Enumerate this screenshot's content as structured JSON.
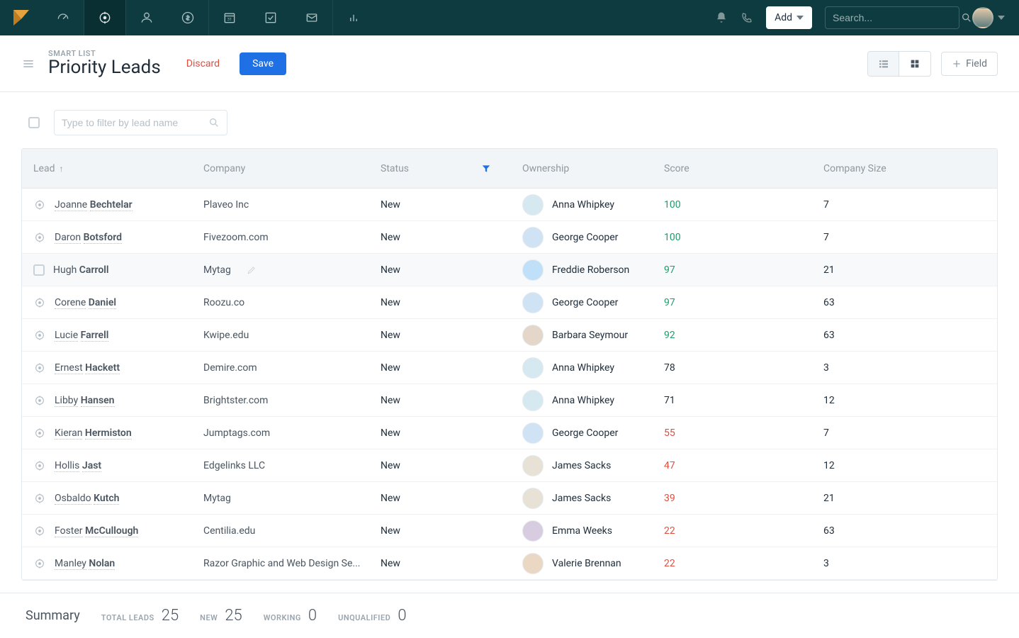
{
  "header": {
    "add_label": "Add",
    "search_placeholder": "Search..."
  },
  "page": {
    "kicker": "SMART LIST",
    "title": "Priority Leads",
    "discard_label": "Discard",
    "save_label": "Save",
    "field_button_label": "Field"
  },
  "filter": {
    "placeholder": "Type to filter by lead name"
  },
  "columns": {
    "lead": "Lead",
    "company": "Company",
    "status": "Status",
    "ownership": "Ownership",
    "score": "Score",
    "company_size": "Company Size",
    "sort_arrow": "↑"
  },
  "rows": [
    {
      "first": "Joanne",
      "last": "Bechtelar",
      "company": "Plaveo Inc",
      "status": "New",
      "owner": "Anna Whipkey",
      "score": "100",
      "score_class": "green",
      "size": "7",
      "hovered": false,
      "checkbox": false,
      "avatar": "#d6e8f0"
    },
    {
      "first": "Daron",
      "last": "Botsford",
      "company": "Fivezoom.com",
      "status": "New",
      "owner": "George Cooper",
      "score": "100",
      "score_class": "green",
      "size": "7",
      "hovered": false,
      "checkbox": false,
      "avatar": "#cfe3f5"
    },
    {
      "first": "Hugh",
      "last": "Carroll",
      "company": "Mytag",
      "status": "New",
      "owner": "Freddie Roberson",
      "score": "97",
      "score_class": "green",
      "size": "21",
      "hovered": true,
      "checkbox": true,
      "pencil": true,
      "avatar": "#bfe0f8"
    },
    {
      "first": "Corene",
      "last": "Daniel",
      "company": "Roozu.co",
      "status": "New",
      "owner": "George Cooper",
      "score": "97",
      "score_class": "green",
      "size": "63",
      "hovered": false,
      "checkbox": false,
      "avatar": "#cfe3f5"
    },
    {
      "first": "Lucie",
      "last": "Farrell",
      "company": "Kwipe.edu",
      "status": "New",
      "owner": "Barbara Seymour",
      "score": "92",
      "score_class": "green",
      "size": "63",
      "hovered": false,
      "checkbox": false,
      "avatar": "#e4d6c8"
    },
    {
      "first": "Ernest",
      "last": "Hackett",
      "company": "Demire.com",
      "status": "New",
      "owner": "Anna Whipkey",
      "score": "78",
      "score_class": "",
      "size": "3",
      "hovered": false,
      "checkbox": false,
      "avatar": "#d6e8f0"
    },
    {
      "first": "Libby",
      "last": "Hansen",
      "company": "Brightster.com",
      "status": "New",
      "owner": "Anna Whipkey",
      "score": "71",
      "score_class": "",
      "size": "12",
      "hovered": false,
      "checkbox": false,
      "avatar": "#d6e8f0"
    },
    {
      "first": "Kieran",
      "last": "Hermiston",
      "company": "Jumptags.com",
      "status": "New",
      "owner": "George Cooper",
      "score": "55",
      "score_class": "red",
      "size": "7",
      "hovered": false,
      "checkbox": false,
      "avatar": "#cfe3f5"
    },
    {
      "first": "Hollis",
      "last": "Jast",
      "company": "Edgelinks LLC",
      "status": "New",
      "owner": "James Sacks",
      "score": "47",
      "score_class": "red",
      "size": "12",
      "hovered": false,
      "checkbox": false,
      "avatar": "#e8e1d6"
    },
    {
      "first": "Osbaldo",
      "last": "Kutch",
      "company": "Mytag",
      "status": "New",
      "owner": "James Sacks",
      "score": "39",
      "score_class": "red",
      "size": "21",
      "hovered": false,
      "checkbox": false,
      "avatar": "#e8e1d6"
    },
    {
      "first": "Foster",
      "last": "McCullough",
      "company": "Centilia.edu",
      "status": "New",
      "owner": "Emma Weeks",
      "score": "22",
      "score_class": "red",
      "size": "63",
      "hovered": false,
      "checkbox": false,
      "avatar": "#d8cde0"
    },
    {
      "first": "Manley",
      "last": "Nolan",
      "company": "Razor Graphic and Web Design Se...",
      "status": "New",
      "owner": "Valerie Brennan",
      "score": "22",
      "score_class": "red",
      "size": "3",
      "hovered": false,
      "checkbox": false,
      "avatar": "#ead8c4"
    }
  ],
  "summary": {
    "label": "Summary",
    "total_leads_k": "TOTAL LEADS",
    "total_leads_v": "25",
    "new_k": "NEW",
    "new_v": "25",
    "working_k": "WORKING",
    "working_v": "0",
    "unqualified_k": "UNQUALIFIED",
    "unqualified_v": "0"
  }
}
